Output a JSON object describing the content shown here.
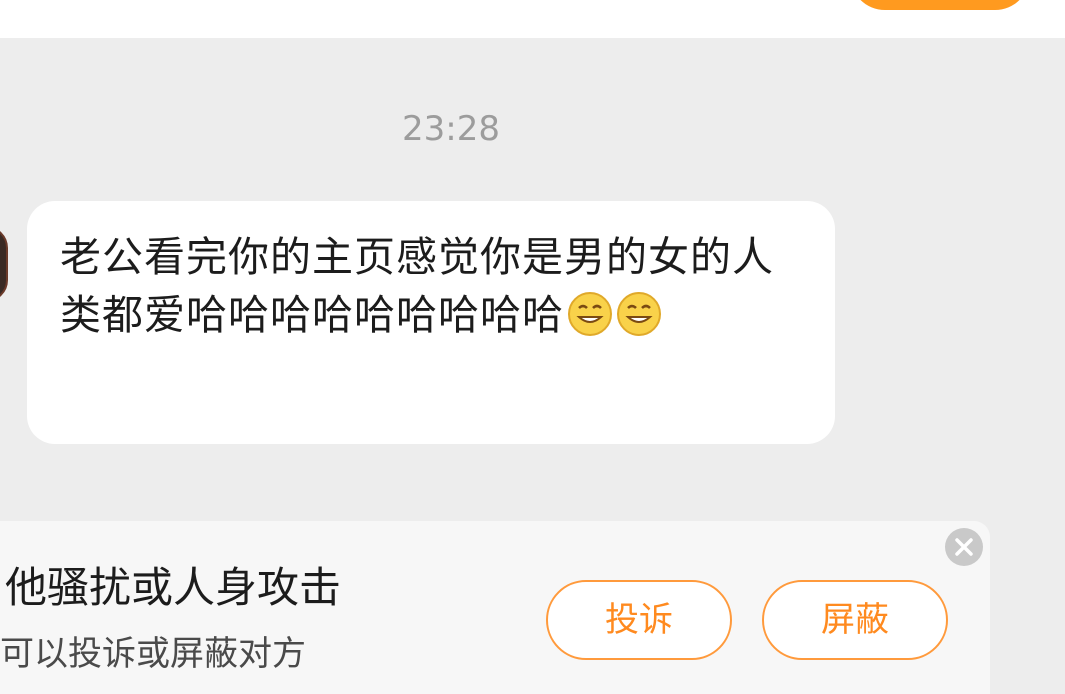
{
  "header": {
    "action_icon": "orange-pill-button",
    "accent_color": "#ff9a1f"
  },
  "chat": {
    "timestamp": "23:28",
    "message": {
      "text": "老公看完你的主页感觉你是男的女的人类都爱哈哈哈哈哈哈哈哈哈",
      "emojis": [
        "grin-emoji",
        "grin-emoji"
      ]
    }
  },
  "notice": {
    "title": "他骚扰或人身攻击",
    "subtitle": "可以投诉或屏蔽对方",
    "report_label": "投诉",
    "block_label": "屏蔽",
    "close_icon": "close-icon",
    "button_color": "#ff8a1f"
  }
}
